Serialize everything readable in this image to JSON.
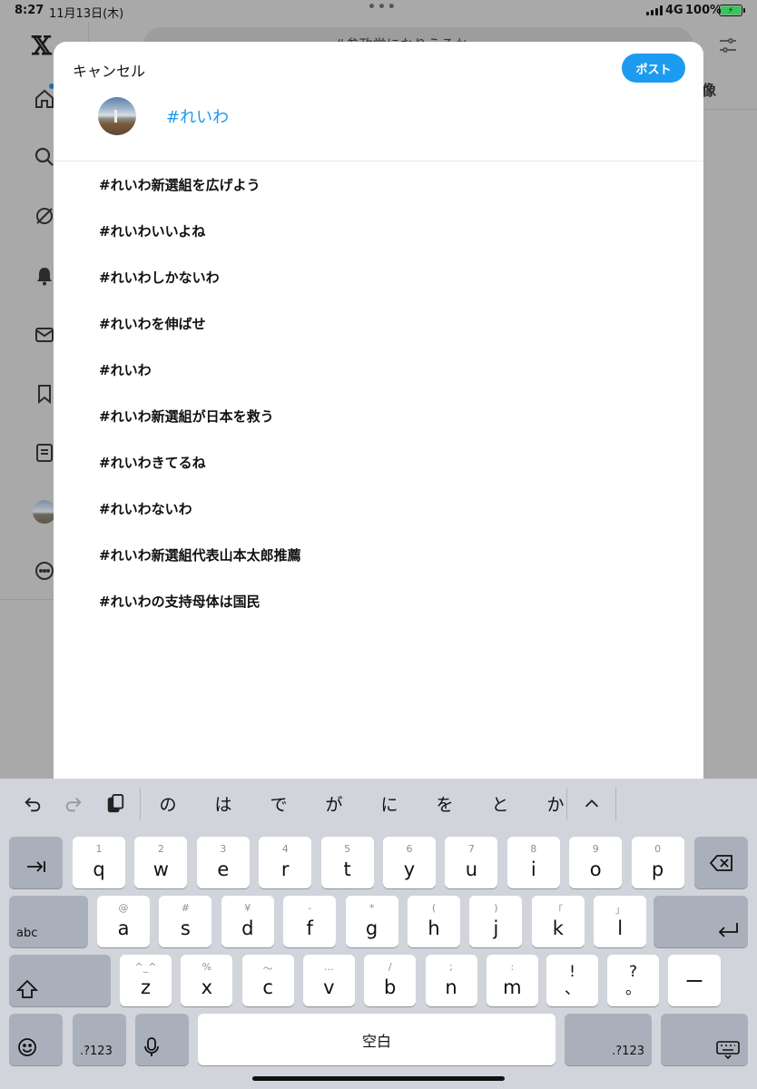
{
  "status_bar": {
    "time": "8:27",
    "date": "11月13日(木)",
    "network": "4G",
    "battery": "100%"
  },
  "background": {
    "search_text": "#参政党になりうるか",
    "tab_partial": "像"
  },
  "composer": {
    "cancel_label": "キャンセル",
    "post_label": "ポスト",
    "text": "#れいわ",
    "accent_color": "#1d9bf0"
  },
  "suggestions": [
    "#れいわ新選組を広げよう",
    "#れいわいいよね",
    "#れいわしかないわ",
    "#れいわを伸ばせ",
    "#れいわ",
    "#れいわ新選組が日本を救う",
    "#れいわきてるね",
    "#れいわないわ",
    "#れいわ新選組代表山本太郎推薦",
    "#れいわの支持母体は国民"
  ],
  "keyboard": {
    "candidates": [
      "の",
      "は",
      "で",
      "が",
      "に",
      "を",
      "と",
      "か"
    ],
    "row1": [
      {
        "sub": "1",
        "main": "q"
      },
      {
        "sub": "2",
        "main": "w"
      },
      {
        "sub": "3",
        "main": "e"
      },
      {
        "sub": "4",
        "main": "r"
      },
      {
        "sub": "5",
        "main": "t"
      },
      {
        "sub": "6",
        "main": "y"
      },
      {
        "sub": "7",
        "main": "u"
      },
      {
        "sub": "8",
        "main": "i"
      },
      {
        "sub": "9",
        "main": "o"
      },
      {
        "sub": "0",
        "main": "p"
      }
    ],
    "row2": [
      {
        "sub": "@",
        "main": "a"
      },
      {
        "sub": "#",
        "main": "s"
      },
      {
        "sub": "¥",
        "main": "d"
      },
      {
        "sub": "-",
        "main": "f"
      },
      {
        "sub": "*",
        "main": "g"
      },
      {
        "sub": "(",
        "main": "h"
      },
      {
        "sub": ")",
        "main": "j"
      },
      {
        "sub": "「",
        "main": "k"
      },
      {
        "sub": "」",
        "main": "l"
      }
    ],
    "row3": [
      {
        "sub": "^_^",
        "main": "z"
      },
      {
        "sub": "%",
        "main": "x"
      },
      {
        "sub": "〜",
        "main": "c"
      },
      {
        "sub": "…",
        "main": "v"
      },
      {
        "sub": "/",
        "main": "b"
      },
      {
        "sub": ";",
        "main": "n"
      },
      {
        "sub": ":",
        "main": "m"
      }
    ],
    "punct1": {
      "top": "!",
      "bottom": "、"
    },
    "punct2": {
      "top": "?",
      "bottom": "。"
    },
    "dash": "ー",
    "abc_label": "abc",
    "num_label": ".?123",
    "space_label": "空白"
  }
}
